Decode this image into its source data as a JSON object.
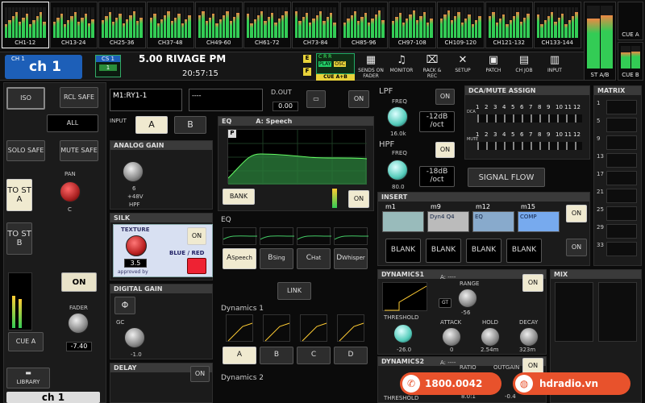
{
  "meters": {
    "groups": [
      "CH1-12",
      "CH13-24",
      "CH25-36",
      "CH37-48",
      "CH49-60",
      "CH61-72",
      "CH73-84",
      "CH85-96",
      "CH97-108",
      "CH109-120",
      "CH121-132",
      "CH133-144"
    ],
    "st_ab": "ST A/B",
    "cue_a": "CUE A",
    "cue_b": "CUE B"
  },
  "header": {
    "ch_small": "CH 1",
    "ch_name": "ch 1",
    "cs_label": "CS 1",
    "cs_num": "1",
    "scene": "5.00  RIVAGE PM",
    "time": "20:57:15",
    "e_badge": "E",
    "f_badge": "F",
    "rec": "R",
    "play": "PLAY",
    "c_r_r": "C  R  R",
    "osc": "OSC",
    "cue_ab": "CUE A+B",
    "tools": [
      {
        "icon": "▦",
        "label": "SENDS ON FADER"
      },
      {
        "icon": "♫",
        "label": "MONITOR"
      },
      {
        "icon": "⌧",
        "label": "RACK & REC"
      },
      {
        "icon": "✕",
        "label": "SETUP"
      },
      {
        "icon": "▣",
        "label": "PATCH"
      },
      {
        "icon": "▤",
        "label": "CH JOB"
      },
      {
        "icon": "▥",
        "label": "INPUT"
      }
    ]
  },
  "left": {
    "iso": "ISO",
    "rcl_safe": "RCL SAFE",
    "all": "ALL",
    "solo_safe": "SOLO SAFE",
    "mute_safe": "MUTE SAFE",
    "to_st_a": "TO ST A",
    "pan": "PAN",
    "pan_val": "C",
    "to_st_b": "TO ST B",
    "on": "ON",
    "fader": "FADER",
    "fader_val": "-7.40",
    "cue_a": "CUE A",
    "library": "LIBRARY",
    "bottom_ch": "ch 1"
  },
  "input": {
    "patch": "M1:RY1-1",
    "patch2": "----",
    "input_label": "INPUT",
    "a": "A",
    "b": "B",
    "analog_gain": "ANALOG GAIN",
    "gain_val": "6",
    "phantom": "+48V",
    "hpf": "HPF",
    "silk": "SILK",
    "texture": "TEXTURE",
    "texture_val": "3.5",
    "approved_by": "approved by",
    "blue_red": "BLUE / RED",
    "silk_on": "ON",
    "digital_gain": "DIGITAL GAIN",
    "phase": "Φ",
    "gc": "GC",
    "dg_val": "-1.0",
    "delay": "DELAY",
    "delay_on": "ON"
  },
  "dout": {
    "label": "D.OUT",
    "val": "0.00",
    "on": "ON"
  },
  "eq": {
    "title": "EQ",
    "preset": "A: Speech",
    "p": "P",
    "bank": "BANK",
    "on": "ON",
    "eq2": "EQ",
    "presets": [
      {
        "letter": "A",
        "name": "Speech"
      },
      {
        "letter": "B",
        "name": "Sing"
      },
      {
        "letter": "C",
        "name": "Hat"
      },
      {
        "letter": "D",
        "name": "Whisper"
      }
    ],
    "link": "LINK",
    "dyn1": "Dynamics 1",
    "dyn_presets": [
      "A",
      "B",
      "C",
      "D"
    ],
    "dyn2": "Dynamics 2"
  },
  "filters": {
    "lpf": "LPF",
    "lpf_freq": "FREQ",
    "lpf_val": "16.0k",
    "lpf_on": "ON",
    "lpf_slope": "-12dB /oct",
    "hpf": "HPF",
    "hpf_freq": "FREQ",
    "hpf_val": "80.0",
    "hpf_on": "ON",
    "hpf_slope": "-18dB /oct"
  },
  "dca": {
    "title": "DCA/MUTE ASSIGN",
    "nums": [
      "1",
      "2",
      "3",
      "4",
      "5",
      "6",
      "7",
      "8",
      "9",
      "10",
      "11",
      "12"
    ],
    "dca_label": "DCA",
    "mute_label": "MUTE",
    "signal_flow": "SIGNAL FLOW"
  },
  "insert": {
    "title": "INSERT",
    "slots": [
      "m1",
      "m9",
      "m12",
      "m15"
    ],
    "slot_names": [
      "",
      "Dyn4 Q4",
      "EQ",
      "COMP"
    ],
    "on": "ON",
    "blank": [
      "BLANK",
      "BLANK",
      "BLANK",
      "BLANK"
    ],
    "on2": "ON"
  },
  "dynamics1": {
    "title": "DYNAMICS1",
    "a_val": "A: ----",
    "range": "RANGE",
    "range_val": "-56",
    "threshold": "THRESHOLD",
    "th_val": "-26.0",
    "attack": "ATTACK",
    "attack_val": "0",
    "hold": "HOLD",
    "hold_val": "2.54m",
    "decay": "DECAY",
    "decay_val": "323m",
    "on": "ON",
    "gt": "GT"
  },
  "dynamics2": {
    "title": "DYNAMICS2",
    "a_val": "A: ----",
    "threshold": "THRESHOLD",
    "ratio": "RATIO",
    "ratio_val": "8.0:1",
    "outgain": "OUTGAIN",
    "outgain_val": "-0.4",
    "on": "ON"
  },
  "matrix": {
    "title": "MATRIX",
    "nums": [
      "1",
      "5",
      "9",
      "13",
      "17",
      "21",
      "25",
      "29",
      "33"
    ],
    "mix": "MIX"
  },
  "badge": {
    "phone": "1800.0042",
    "site": "hdradio.vn"
  }
}
